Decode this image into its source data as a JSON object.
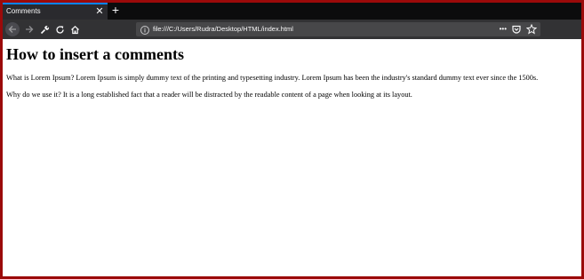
{
  "browser": {
    "tab": {
      "title": "Comments",
      "close_glyph": "✕"
    },
    "new_tab_glyph": "+",
    "toolbar": {
      "icons": [
        "back-arrow-icon",
        "forward-arrow-icon",
        "wrench-icon",
        "reload-icon",
        "home-icon"
      ]
    },
    "address_bar": {
      "url": "file:///C:/Users/Rudra/Desktop/HTML/index.html",
      "page_actions_glyph": "•••",
      "icons": [
        "info-icon",
        "page-actions-icon",
        "pocket-icon",
        "bookmark-star-icon"
      ]
    }
  },
  "page": {
    "heading": "How to insert a comments",
    "paragraphs": [
      "What is Lorem Ipsum? Lorem Ipsum is simply dummy text of the printing and typesetting industry. Lorem Ipsum has been the industry's standard dummy text ever since the 1500s.",
      "Why do we use it? It is a long established fact that a reader will be distracted by the readable content of a page when looking at its layout."
    ]
  },
  "colors": {
    "frame_border": "#9b0a0a",
    "tab_bar": "#0c0c0d",
    "active_tab": "#2a2a2e",
    "nav_bar": "#323234",
    "url_field": "#474749",
    "tab_accent": "#0a84ff"
  }
}
